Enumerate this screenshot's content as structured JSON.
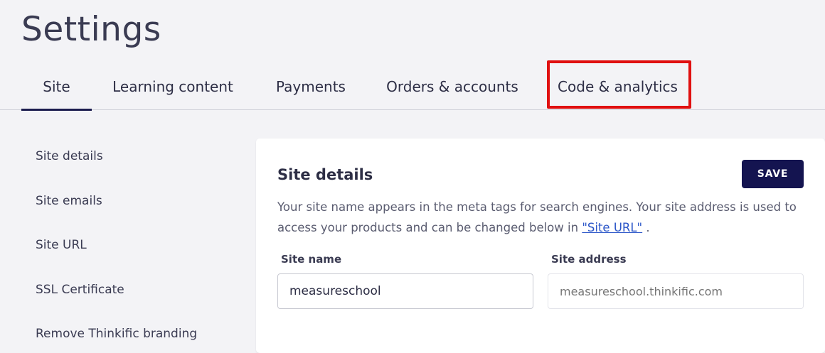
{
  "page": {
    "title": "Settings"
  },
  "tabs": [
    {
      "label": "Site",
      "active": true
    },
    {
      "label": "Learning content",
      "active": false
    },
    {
      "label": "Payments",
      "active": false
    },
    {
      "label": "Orders & accounts",
      "active": false
    },
    {
      "label": "Code & analytics",
      "active": false,
      "highlighted": true
    }
  ],
  "sidenav": {
    "items": [
      {
        "label": "Site details"
      },
      {
        "label": "Site emails"
      },
      {
        "label": "Site URL"
      },
      {
        "label": "SSL Certificate"
      },
      {
        "label": "Remove Thinkific branding"
      }
    ]
  },
  "card": {
    "title": "Site details",
    "save_label": "SAVE",
    "description_before": "Your site name appears in the meta tags for search engines. Your site address is used to access your products and can be changed below in ",
    "description_link": "\"Site URL\"",
    "description_after": " .",
    "fields": {
      "site_name": {
        "label": "Site name",
        "value": "measureschool"
      },
      "site_address": {
        "label": "Site address",
        "placeholder": "measureschool.thinkific.com"
      }
    }
  },
  "colors": {
    "accent": "#141450",
    "highlight": "#e01010",
    "link": "#2b56c8",
    "background": "#f3f3f6"
  }
}
